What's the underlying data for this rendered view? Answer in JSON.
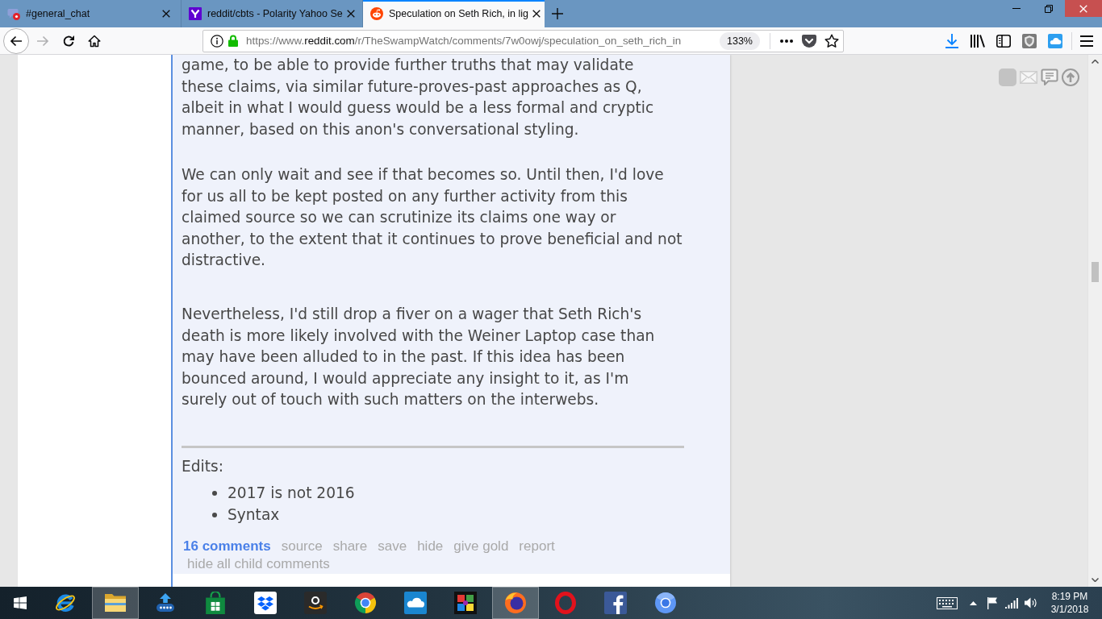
{
  "tabs": [
    {
      "kind": "chat",
      "title": "#general_chat",
      "selected": false
    },
    {
      "kind": "search",
      "title": "reddit/cbts - Polarity Yahoo Se",
      "selected": false
    },
    {
      "kind": "forum",
      "title": "Speculation on Seth Rich, in lig",
      "selected": true
    }
  ],
  "toolbar": {
    "back": {
      "disabled": false
    },
    "forward": {
      "disabled": true
    },
    "address": {
      "prefix": "https://www.",
      "host": "reddit.com",
      "path": "/r/TheSwampWatch/comments/7w0owj/speculation_on_seth_rich_in"
    },
    "zoom": "133%"
  },
  "post": {
    "paragraphs": [
      {
        "lines": [
          "game, to be able to provide further truths that may validate",
          "these claims, via similar future-proves-past approaches as Q,",
          "albeit in what I would guess would be a less formal and cryptic",
          "manner, based on this anon's conversational styling."
        ]
      },
      {
        "lines": [
          "We can only wait and see if that becomes so. Until then, I'd love",
          "for us all to be kept posted on any further activity from this",
          "claimed source so we can scrutinize its claims one way or",
          "another, to the extent that it continues to prove beneficial and not",
          "distractive."
        ]
      },
      {
        "lines": [
          "Nevertheless, I'd still drop a fiver on a wager that Seth Rich's",
          "death is more likely involved with the Weiner Laptop case than",
          "may have been alluded to in the past. If this idea has been",
          "bounced around, I would appreciate any insight to it, as I'm",
          "surely out of touch with such matters on the interwebs."
        ]
      }
    ],
    "edits": {
      "heading": "Edits:",
      "items": [
        "2017 is not 2016",
        "Syntax"
      ]
    },
    "links": [
      {
        "kind": "count",
        "label": "16 comments"
      },
      {
        "kind": "action",
        "label": "source"
      },
      {
        "kind": "action",
        "label": "share"
      },
      {
        "kind": "action",
        "label": "save"
      },
      {
        "kind": "action",
        "label": "hide"
      },
      {
        "kind": "action",
        "label": "give gold"
      },
      {
        "kind": "action",
        "label": "report"
      }
    ],
    "child_toggle": "hide all child comments"
  },
  "taskbar": {
    "apps": [
      {
        "kind": "globe",
        "active": false
      },
      {
        "kind": "folder",
        "active": true
      },
      {
        "kind": "upload",
        "active": false
      },
      {
        "kind": "bag",
        "active": false
      },
      {
        "kind": "box",
        "active": false
      },
      {
        "kind": "smile",
        "active": false
      },
      {
        "kind": "wheel",
        "active": false
      },
      {
        "kind": "cloud",
        "active": false
      },
      {
        "kind": "puzzle",
        "active": false
      },
      {
        "kind": "fox",
        "active": true
      },
      {
        "kind": "ring",
        "active": false
      },
      {
        "kind": "f",
        "active": false
      },
      {
        "kind": "orb",
        "active": false
      }
    ],
    "clock": {
      "time": "8:19 PM",
      "date": "3/1/2018"
    }
  }
}
